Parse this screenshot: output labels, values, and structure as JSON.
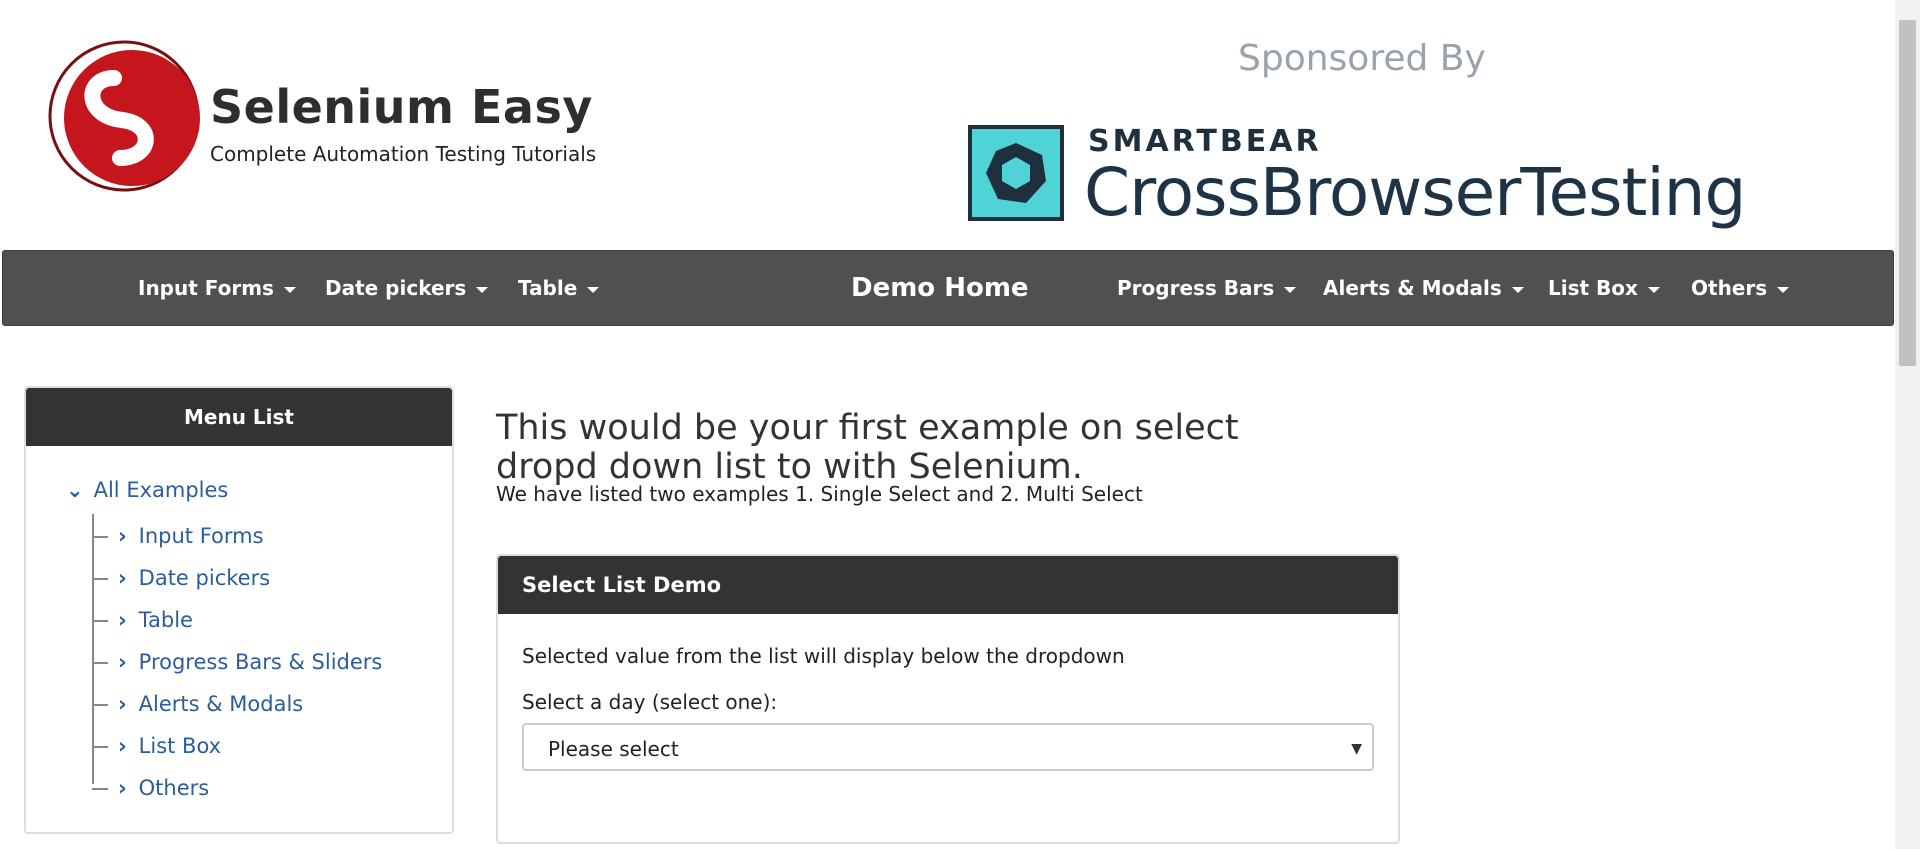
{
  "header": {
    "site_title": "Selenium Easy",
    "tagline": "Complete Automation Testing Tutorials",
    "sponsored_label": "Sponsored By",
    "sponsor_brand": "SMARTBEAR",
    "sponsor_product": "CrossBrowserTesting"
  },
  "navbar": {
    "items": [
      {
        "label": "Input Forms"
      },
      {
        "label": "Date pickers"
      },
      {
        "label": "Table"
      },
      {
        "label": "Demo Home"
      },
      {
        "label": "Progress Bars"
      },
      {
        "label": "Alerts & Modals"
      },
      {
        "label": "List Box"
      },
      {
        "label": "Others"
      }
    ]
  },
  "sidebar": {
    "title": "Menu List",
    "root": "All Examples",
    "items": [
      {
        "label": "Input Forms"
      },
      {
        "label": "Date pickers"
      },
      {
        "label": "Table"
      },
      {
        "label": "Progress Bars & Sliders"
      },
      {
        "label": "Alerts & Modals"
      },
      {
        "label": "List Box"
      },
      {
        "label": "Others"
      }
    ]
  },
  "main": {
    "title": "This would be your first example on select dropd down list to with Selenium.",
    "subtitle": "We have listed two examples 1. Single Select and 2. Multi Select",
    "panel": {
      "title": "Select List Demo",
      "description": "Selected value from the list will display below the dropdown",
      "label": "Select a day (select one):",
      "select_value": "Please select"
    }
  },
  "colors": {
    "navbar": "#505050",
    "panel_header": "#333333",
    "link": "#2d5d99",
    "logo_red": "#c4161c",
    "cbt_teal": "#4fd3d6"
  }
}
